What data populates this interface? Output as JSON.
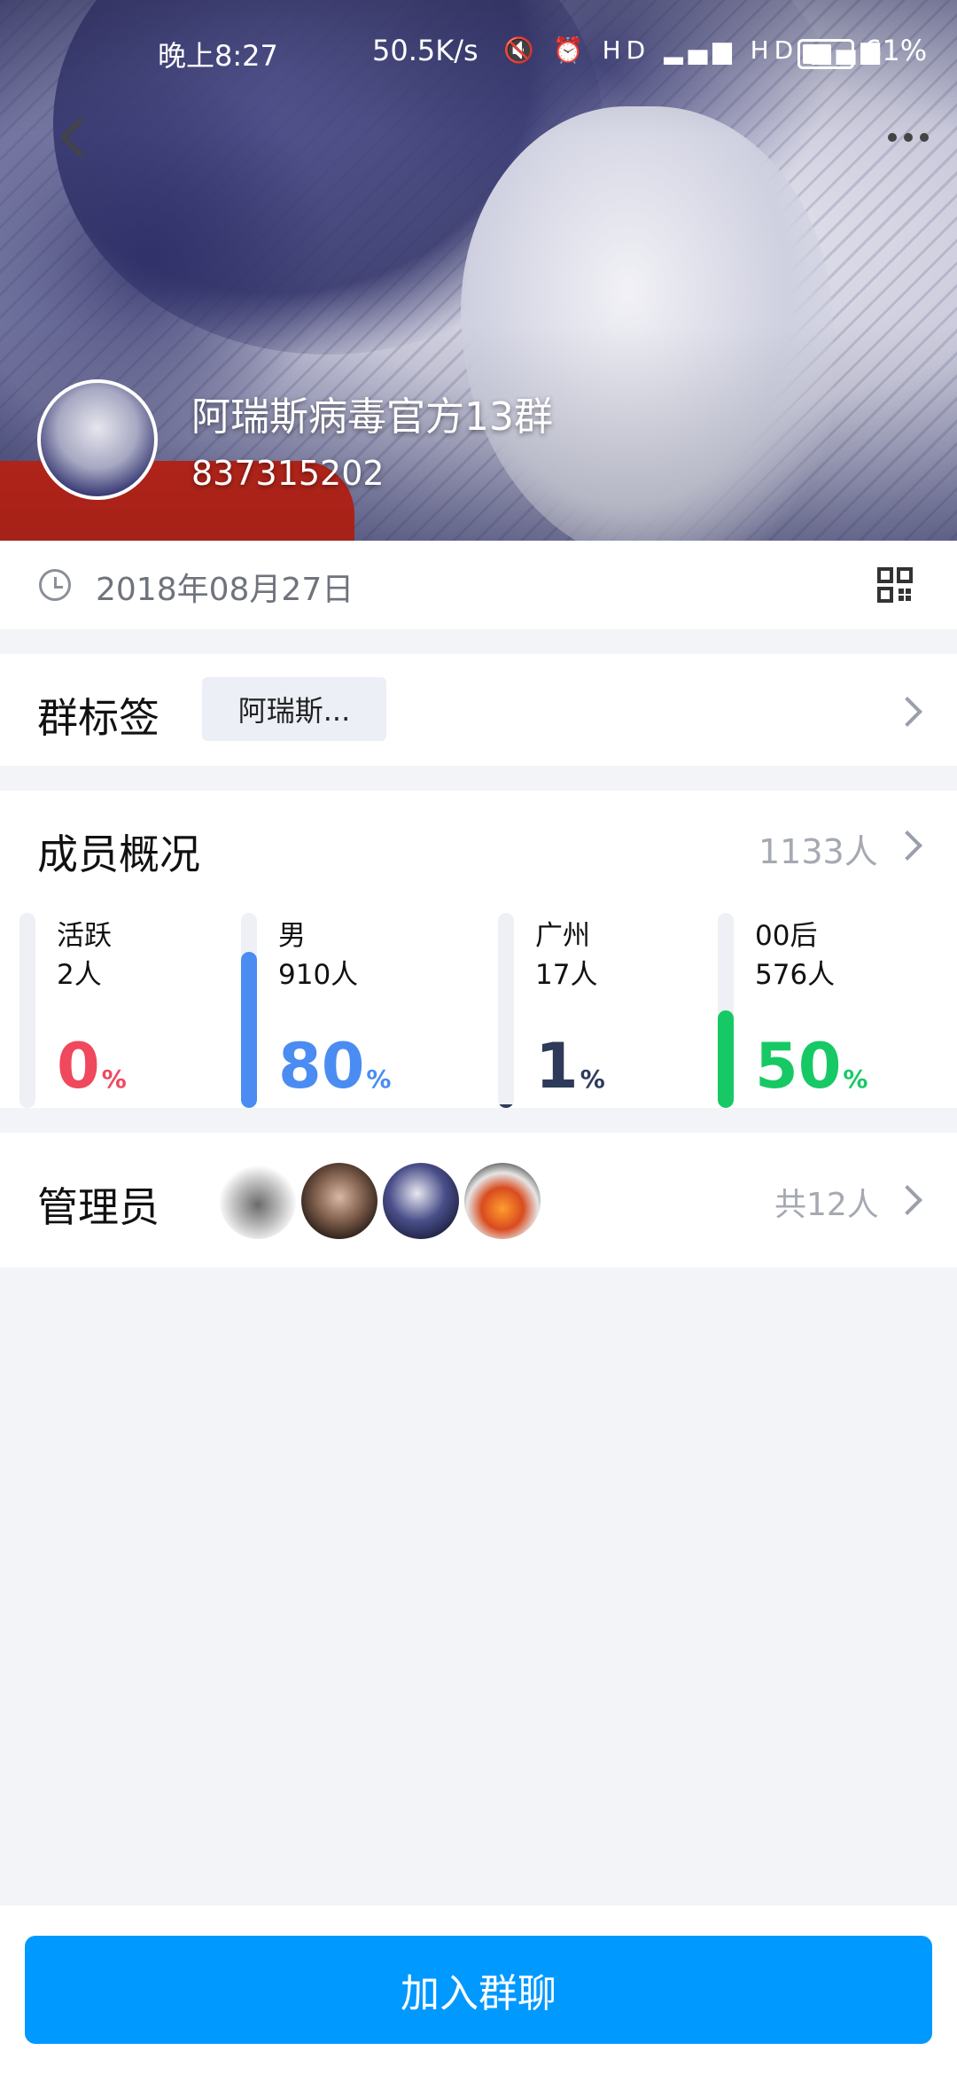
{
  "status_bar": {
    "time": "晚上8:27",
    "net_speed": "50.5K/s",
    "icons": [
      "mute-icon",
      "alarm-icon",
      "hd-icon",
      "4g-signal-icon",
      "hd-icon",
      "5g-signal-icon"
    ],
    "battery_level": 0.61,
    "battery_text": "61%"
  },
  "header": {
    "back_icon": "chevron-left-icon",
    "more_icon": "more-horizontal-icon"
  },
  "group": {
    "name": "阿瑞斯病毒官方13群",
    "id": "837315202",
    "created_date": "2018年08月27日",
    "qr_icon": "qr-code-icon"
  },
  "tags": {
    "label": "群标签",
    "chip": "阿瑞斯..."
  },
  "members": {
    "title": "成员概况",
    "total": "1133人",
    "stats": [
      {
        "label": "活跃",
        "count": "2人",
        "percent": "0",
        "unit": "%",
        "value": 0,
        "color": "#f0485c"
      },
      {
        "label": "男",
        "count": "910人",
        "percent": "80",
        "unit": "%",
        "value": 80,
        "color": "#4a8cf2"
      },
      {
        "label": "广州",
        "count": "17人",
        "percent": "1",
        "unit": "%",
        "value": 1,
        "color": "#2d3a5a"
      },
      {
        "label": "00后",
        "count": "576人",
        "percent": "50",
        "unit": "%",
        "value": 50,
        "color": "#17c964"
      }
    ]
  },
  "admins": {
    "label": "管理员",
    "total": "共12人",
    "avatars": [
      "avatar-knight",
      "avatar-portrait",
      "avatar-anime",
      "avatar-cartoon"
    ]
  },
  "actions": {
    "join_button": "加入群聊"
  },
  "colors": {
    "accent": "#0099ff",
    "page_bg": "#f3f4f8"
  }
}
